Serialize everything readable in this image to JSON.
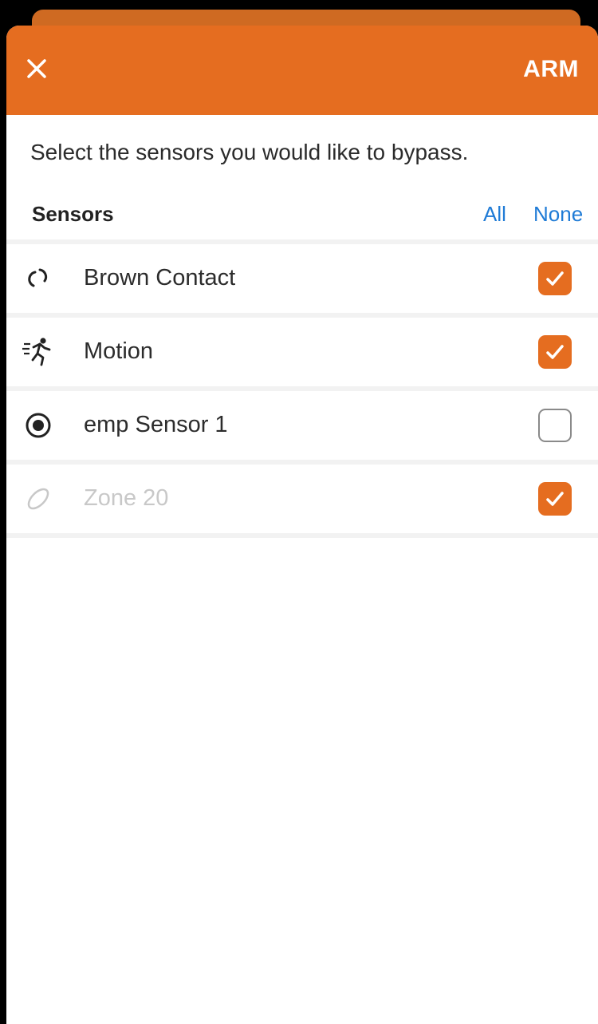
{
  "header": {
    "close_icon": "close-icon",
    "arm_label": "ARM",
    "background_color": "#e56d20"
  },
  "instructions": "Select the sensors you would like to bypass.",
  "sensors_section": {
    "title": "Sensors",
    "select_all_label": "All",
    "select_none_label": "None"
  },
  "sensors": [
    {
      "label": "Brown Contact",
      "icon": "contact-link-icon",
      "checked": true,
      "disabled": false
    },
    {
      "label": "Motion",
      "icon": "motion-running-icon",
      "checked": true,
      "disabled": false
    },
    {
      "label": "emp Sensor 1",
      "icon": "radio-dot-icon",
      "checked": false,
      "disabled": false
    },
    {
      "label": "Zone 20",
      "icon": "zone-oval-icon",
      "checked": true,
      "disabled": true
    }
  ],
  "colors": {
    "accent": "#e56d20",
    "link": "#1f7bd6",
    "disabled_text": "#c8c8c8"
  }
}
